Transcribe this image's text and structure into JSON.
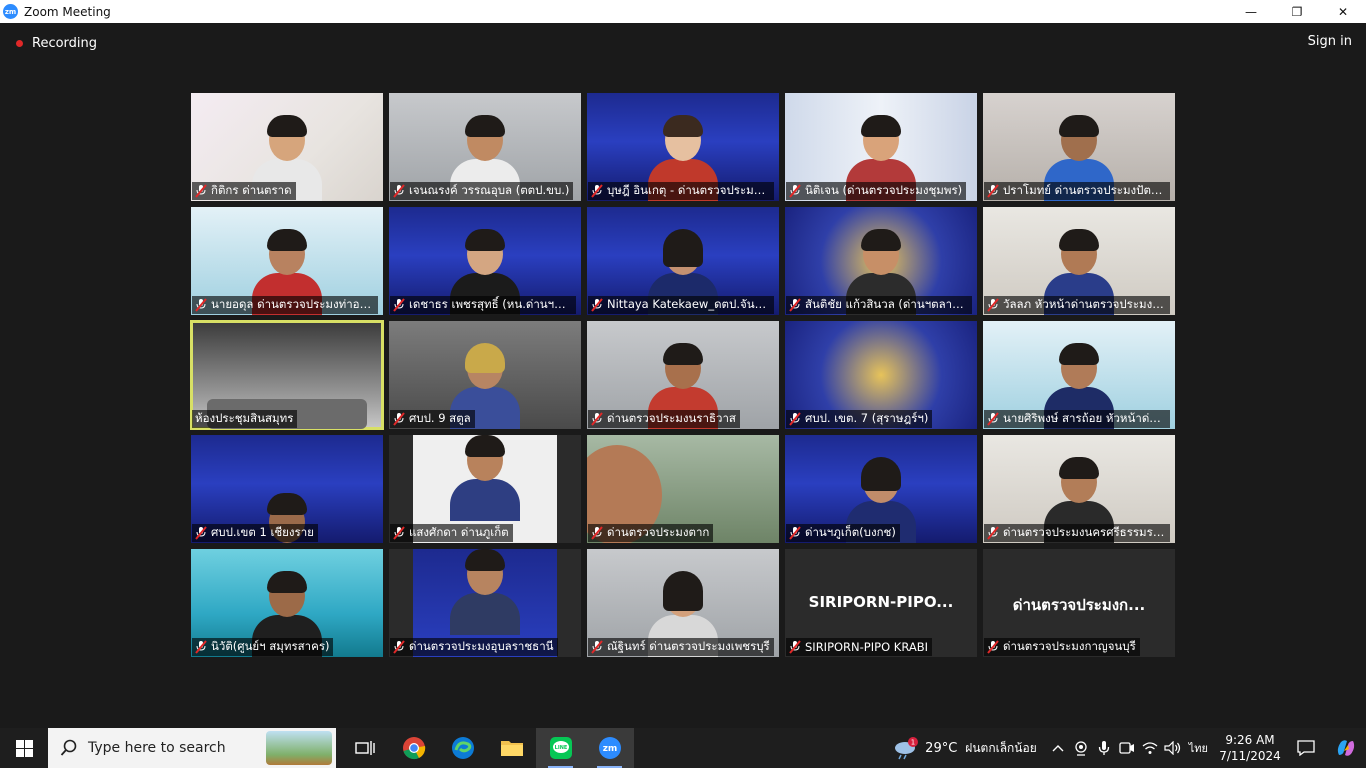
{
  "window": {
    "title": "Zoom Meeting",
    "minimize": "—",
    "maximize": "❐",
    "close": "✕"
  },
  "meeting": {
    "recording_label": "Recording",
    "signin_label": "Sign in"
  },
  "tiles": [
    {
      "name": "กิติกร ด่านตราด"
    },
    {
      "name": "เจนณรงค์ วรรณอุบล (ตตป.ขบ.)"
    },
    {
      "name": "บุษฎี อินเกตุ - ด่านตรวจประมงช..."
    },
    {
      "name": "นิติเจน (ด่านตรวจประมงชุมพร)"
    },
    {
      "name": "ปราโมทย์ ด่านตรวจประมงปัตตานี"
    },
    {
      "name": "นายอดุล  ด่านตรวจประมงท่าอา..."
    },
    {
      "name": "เดชาธร เพชรสุทธิ์ (หน.ด่านฯดอ..."
    },
    {
      "name": "Nittaya Katekaew_ดตป.จันทบุรี"
    },
    {
      "name": "สันติชัย แก้วสินวล (ด่านฯตลาดกร..."
    },
    {
      "name": "วัลลภ หัวหน้าด่านตรวจประมงสุร..."
    },
    {
      "name": "ห้องประชุมสินสมุทร"
    },
    {
      "name": "ศบป. 9 สตูล"
    },
    {
      "name": "ด่านตรวจประมงนราธิวาส"
    },
    {
      "name": "ศบป. เขต. 7 (สุราษฎร์ฯ)"
    },
    {
      "name": "นายศิริพงษ์  สารถ้อย หัวหน้าด่า..."
    },
    {
      "name": "ศบป.เขต 1 เชียงราย"
    },
    {
      "name": "แสงศักดา ด่านภูเก็ต"
    },
    {
      "name": "ด่านตรวจประมงตาก"
    },
    {
      "name": "ด่านฯภูเก็ต(บงกช)"
    },
    {
      "name": "ด่านตรวจประมงนครศรีธรรมราช"
    },
    {
      "name": "นิวัติ(ศูนย์ฯ สมุทรสาคร)"
    },
    {
      "name": "ด่านตรวจประมงอุบลราชธานี"
    },
    {
      "name": "ณัฐินทร์ ด่านตรวจประมงเพชรบุรี"
    },
    {
      "name": "SIRIPORN-PIPO KRABI",
      "center": "SIRIPORN-PIPO..."
    },
    {
      "name": "ด่านตรวจประมงกาญจนบุรี",
      "center": "ด่านตรวจประมงก..."
    }
  ],
  "taskbar": {
    "search_placeholder": "Type here to search",
    "weather_temp": "29°C",
    "weather_cond": "ฝนตกเล็กน้อย",
    "weather_badge": "1",
    "language": "ไทย",
    "time": "9:26 AM",
    "date": "7/11/2024"
  }
}
